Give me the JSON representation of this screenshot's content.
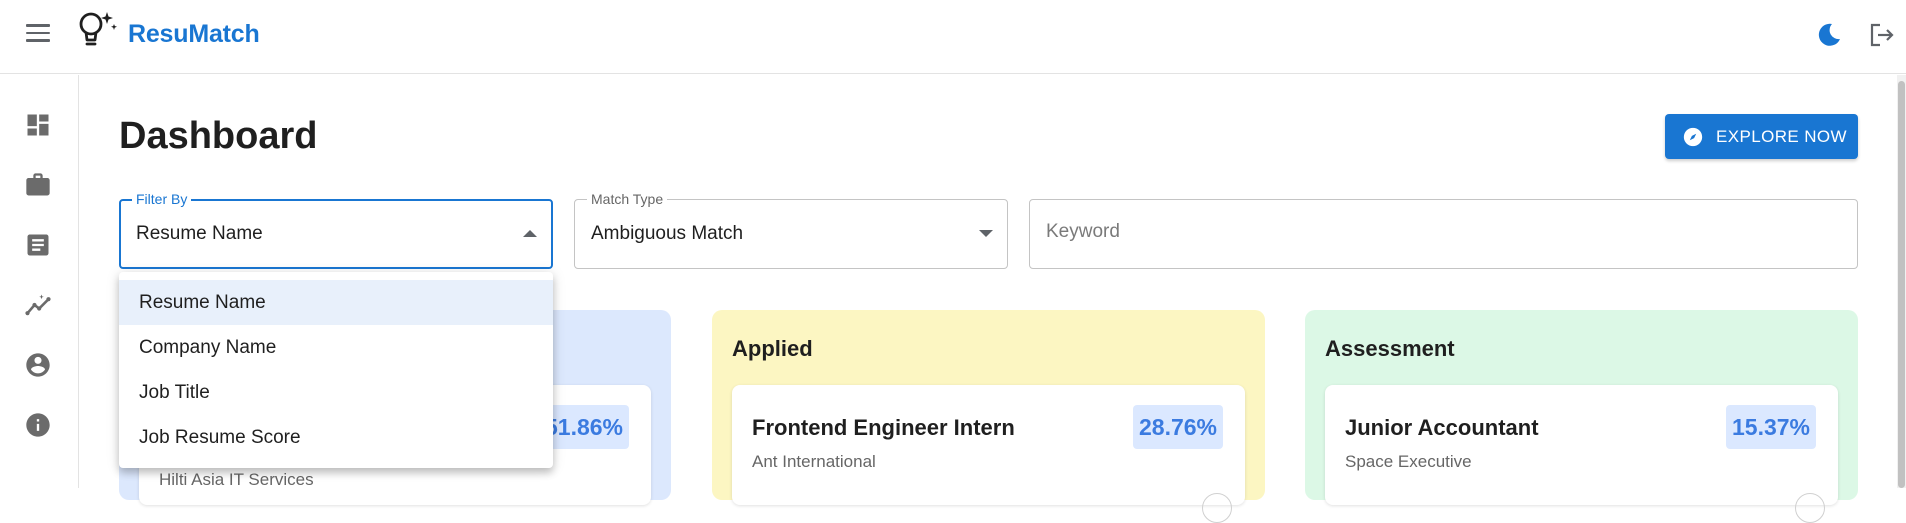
{
  "app": {
    "brand": "ResuMatch"
  },
  "header": {
    "menu_icon": "hamburger-icon",
    "logo_icon": "lightbulb-sparkle-icon",
    "theme_icon": "moon-icon",
    "logout_icon": "logout-icon"
  },
  "sidebar": {
    "items": [
      {
        "name": "dashboard",
        "icon": "dashboard-icon"
      },
      {
        "name": "jobs",
        "icon": "briefcase-icon"
      },
      {
        "name": "resumes",
        "icon": "document-icon"
      },
      {
        "name": "insights",
        "icon": "insights-icon"
      },
      {
        "name": "profile",
        "icon": "account-icon"
      },
      {
        "name": "about",
        "icon": "info-icon"
      }
    ]
  },
  "page": {
    "title": "Dashboard",
    "explore_label": "EXPLORE NOW",
    "explore_icon": "compass-icon"
  },
  "filters": {
    "filter_by": {
      "label": "Filter By",
      "value": "Resume Name"
    },
    "match_type": {
      "label": "Match Type",
      "value": "Ambiguous Match"
    },
    "keyword": {
      "placeholder": "Keyword",
      "value": ""
    }
  },
  "filter_menu": {
    "options": [
      "Resume Name",
      "Company Name",
      "Job Title",
      "Job Resume Score"
    ],
    "selected": "Resume Name"
  },
  "columns": [
    {
      "title": "",
      "color": "#dce8fd",
      "cards": [
        {
          "title": "",
          "company": "Hilti Asia IT Services",
          "score": "51.86%"
        }
      ]
    },
    {
      "title": "Applied",
      "color": "#fcf6c2",
      "cards": [
        {
          "title": "Frontend Engineer Intern",
          "company": "Ant International",
          "score": "28.76%"
        }
      ]
    },
    {
      "title": "Assessment",
      "color": "#dcf8e6",
      "cards": [
        {
          "title": "Junior Accountant",
          "company": "Space Executive",
          "score": "15.37%"
        }
      ]
    }
  ],
  "colors": {
    "primary": "#1976d2",
    "score_text": "#3b7be0",
    "score_bg": "#dbe8ff"
  }
}
